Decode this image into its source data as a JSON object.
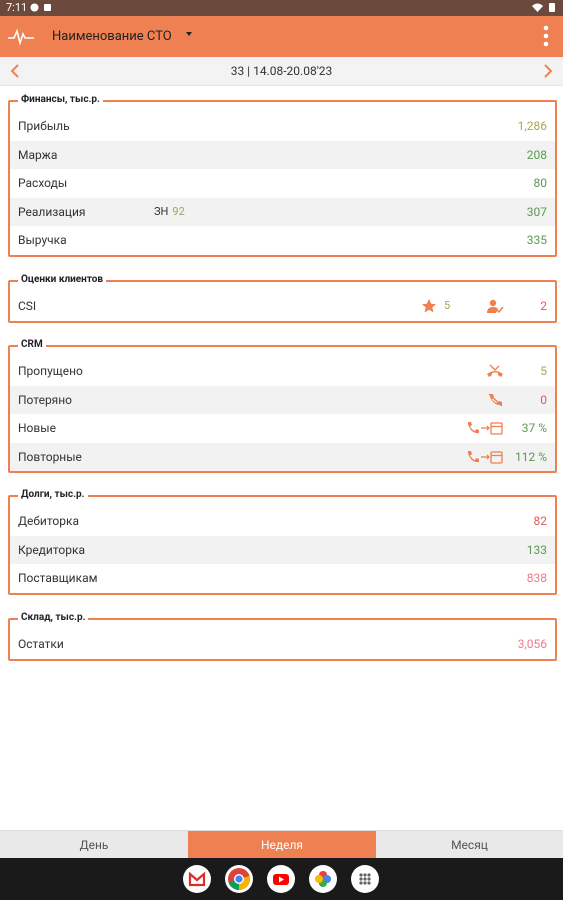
{
  "statusbar": {
    "time": "7:11"
  },
  "toolbar": {
    "title": "Наименование СТО"
  },
  "datebar": {
    "label": "33 | 14.08-20.08'23"
  },
  "finances": {
    "legend": "Финансы, тыс.р.",
    "rows": [
      {
        "label": "Прибыль",
        "value": "1,286",
        "color": "#a8a45a"
      },
      {
        "label": "Маржа",
        "value": "208",
        "color": "#5b9a50"
      },
      {
        "label": "Расходы",
        "value": "80",
        "color": "#5b9a50"
      },
      {
        "label": "Реализация",
        "value": "307",
        "color": "#5b9a50",
        "mid_label": "ЗН",
        "mid_value": "92"
      },
      {
        "label": "Выручка",
        "value": "335",
        "color": "#5b9a50"
      }
    ]
  },
  "ratings": {
    "legend": "Оценки клиентов",
    "csi_label": "CSI",
    "stars": "5",
    "users": "2"
  },
  "crm": {
    "legend": "CRM",
    "rows": [
      {
        "label": "Пропущено",
        "value": "5",
        "icon": "missed-call-icon"
      },
      {
        "label": "Потеряно",
        "value": "0",
        "icon": "lost-call-icon"
      },
      {
        "label": "Новые",
        "value": "37 %",
        "icon": "call-to-calendar-icon"
      },
      {
        "label": "Повторные",
        "value": "112 %",
        "icon": "call-to-calendar-icon"
      }
    ]
  },
  "debts": {
    "legend": "Долги, тыс.р.",
    "rows": [
      {
        "label": "Дебиторка",
        "value": "82",
        "color": "#e05a5a"
      },
      {
        "label": "Кредиторка",
        "value": "133",
        "color": "#5b9a50"
      },
      {
        "label": "Поставщикам",
        "value": "838",
        "color": "#ef7a8a"
      }
    ]
  },
  "warehouse": {
    "legend": "Склад, тыс.р.",
    "rows": [
      {
        "label": "Остатки",
        "value": "3,056",
        "color": "#ef7a8a"
      }
    ]
  },
  "tabs": {
    "day": "День",
    "week": "Неделя",
    "month": "Месяц"
  },
  "colors": {
    "accent": "#ef8052",
    "positive": "#5b9a50",
    "negative": "#e05a5a"
  }
}
